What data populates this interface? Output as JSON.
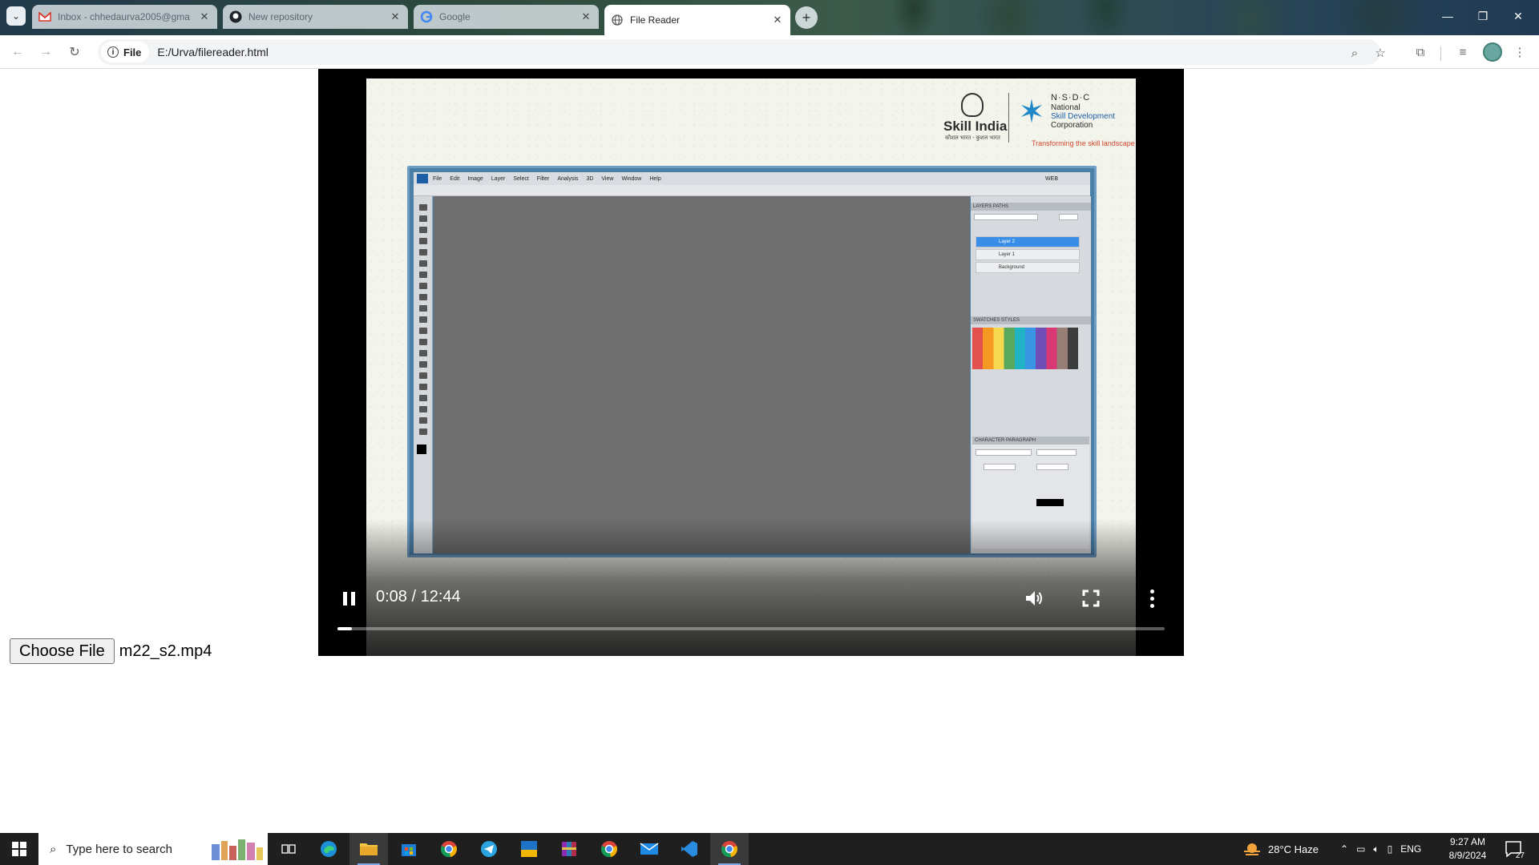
{
  "browser": {
    "tabs": [
      {
        "title": "Inbox - chhedaurva2005@gma",
        "favicon": "gmail-icon",
        "active": false
      },
      {
        "title": "New repository",
        "favicon": "github-icon",
        "active": false
      },
      {
        "title": "Google",
        "favicon": "google-icon",
        "active": false
      },
      {
        "title": "File Reader",
        "favicon": "globe-icon",
        "active": true
      }
    ],
    "site_chip": "File",
    "url": "E:/Urva/filereader.html"
  },
  "video": {
    "logos": {
      "skill_india": "Skill India",
      "skill_india_tagline": "कौशल भारत - कुशल भारत",
      "nsdc_short": "N·S·D·C",
      "nsdc_lines": [
        "National",
        "Skill Development",
        "Corporation"
      ],
      "nsdc_tagline": "Transforming the skill landscape"
    },
    "photoshop": {
      "menu": [
        "File",
        "Edit",
        "Image",
        "Layer",
        "Select",
        "Filter",
        "Analysis",
        "3D",
        "View",
        "Window",
        "Help"
      ],
      "workspace": "WEB",
      "layers_tabs": "LAYERS   PATHS",
      "layers": [
        "Layer 2",
        "Layer 1",
        "Background"
      ],
      "swatches_tabs": "SWATCHES   STYLES",
      "character_tabs": "CHARACTER   PARAGRAPH"
    },
    "time_display": "0:08 / 12:44",
    "progress": 0.0107,
    "playing": true
  },
  "file_input": {
    "button_label": "Choose File",
    "file_name": "m22_s2.mp4"
  },
  "taskbar": {
    "search_placeholder": "Type here to search",
    "weather": "28°C  Haze",
    "language": "ENG",
    "time": "9:27 AM",
    "date": "8/9/2024",
    "notification_count": "27"
  }
}
